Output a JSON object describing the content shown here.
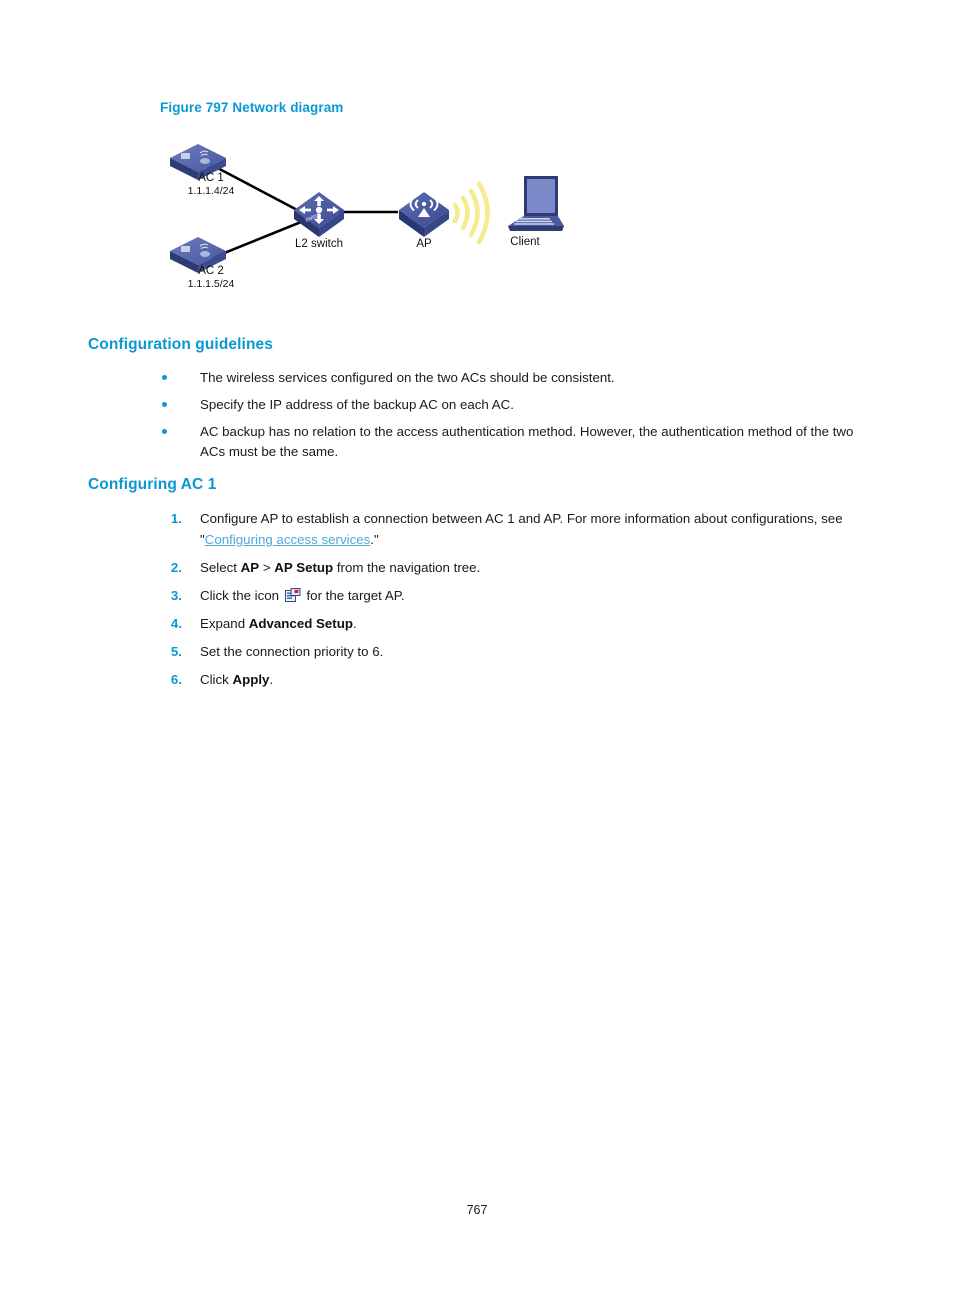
{
  "figure": {
    "caption": "Figure 797 Network diagram",
    "nodes": {
      "ac1": {
        "name": "AC 1",
        "ip": "1.1.1.4/24",
        "icon": "wireless-controller-icon"
      },
      "ac2": {
        "name": "AC 2",
        "ip": "1.1.1.5/24",
        "icon": "wireless-controller-icon"
      },
      "switch": {
        "name": "L2 switch",
        "icon": "switch-icon"
      },
      "ap": {
        "name": "AP",
        "icon": "access-point-icon"
      },
      "client": {
        "name": "Client",
        "icon": "laptop-icon"
      }
    },
    "colors": {
      "device_blue": "#4a5a9e",
      "device_blue_light": "#6d7cc0",
      "device_blue_dark": "#2e3c74",
      "wifi_yellow": "#f6eb8e",
      "link_black": "#000000"
    }
  },
  "sections": {
    "guidelines": {
      "heading": "Configuration guidelines",
      "bullets": [
        "The wireless services configured on the two ACs should be consistent.",
        "Specify the IP address of the backup AC on each AC.",
        "AC backup has no relation to the access authentication method. However, the authentication method of the two ACs must be the same."
      ]
    },
    "configuring_ac1": {
      "heading": "Configuring AC 1",
      "steps": [
        {
          "num": "1.",
          "pre": "Configure AP to establish a connection between AC 1 and AP. For more information about configurations, see \"",
          "link": "Configuring access services",
          "post": ".\""
        },
        {
          "num": "2.",
          "pre": "Select ",
          "bold1": "AP",
          "mid": " > ",
          "bold2": "AP Setup",
          "post": " from the navigation tree."
        },
        {
          "num": "3.",
          "pre": "Click the icon ",
          "icon": "ap-setup-icon",
          "post": " for the target AP."
        },
        {
          "num": "4.",
          "pre": "Expand ",
          "bold1": "Advanced Setup",
          "post": "."
        },
        {
          "num": "5.",
          "pre": "Set the connection priority to 6.",
          "post": ""
        },
        {
          "num": "6.",
          "pre": "Click ",
          "bold1": "Apply",
          "post": "."
        }
      ]
    }
  },
  "footer": {
    "page_number": "767"
  },
  "theme": {
    "heading_blue": "#0b97d4",
    "link_blue": "#50a7dd",
    "body_black": "#1a1a1a"
  }
}
